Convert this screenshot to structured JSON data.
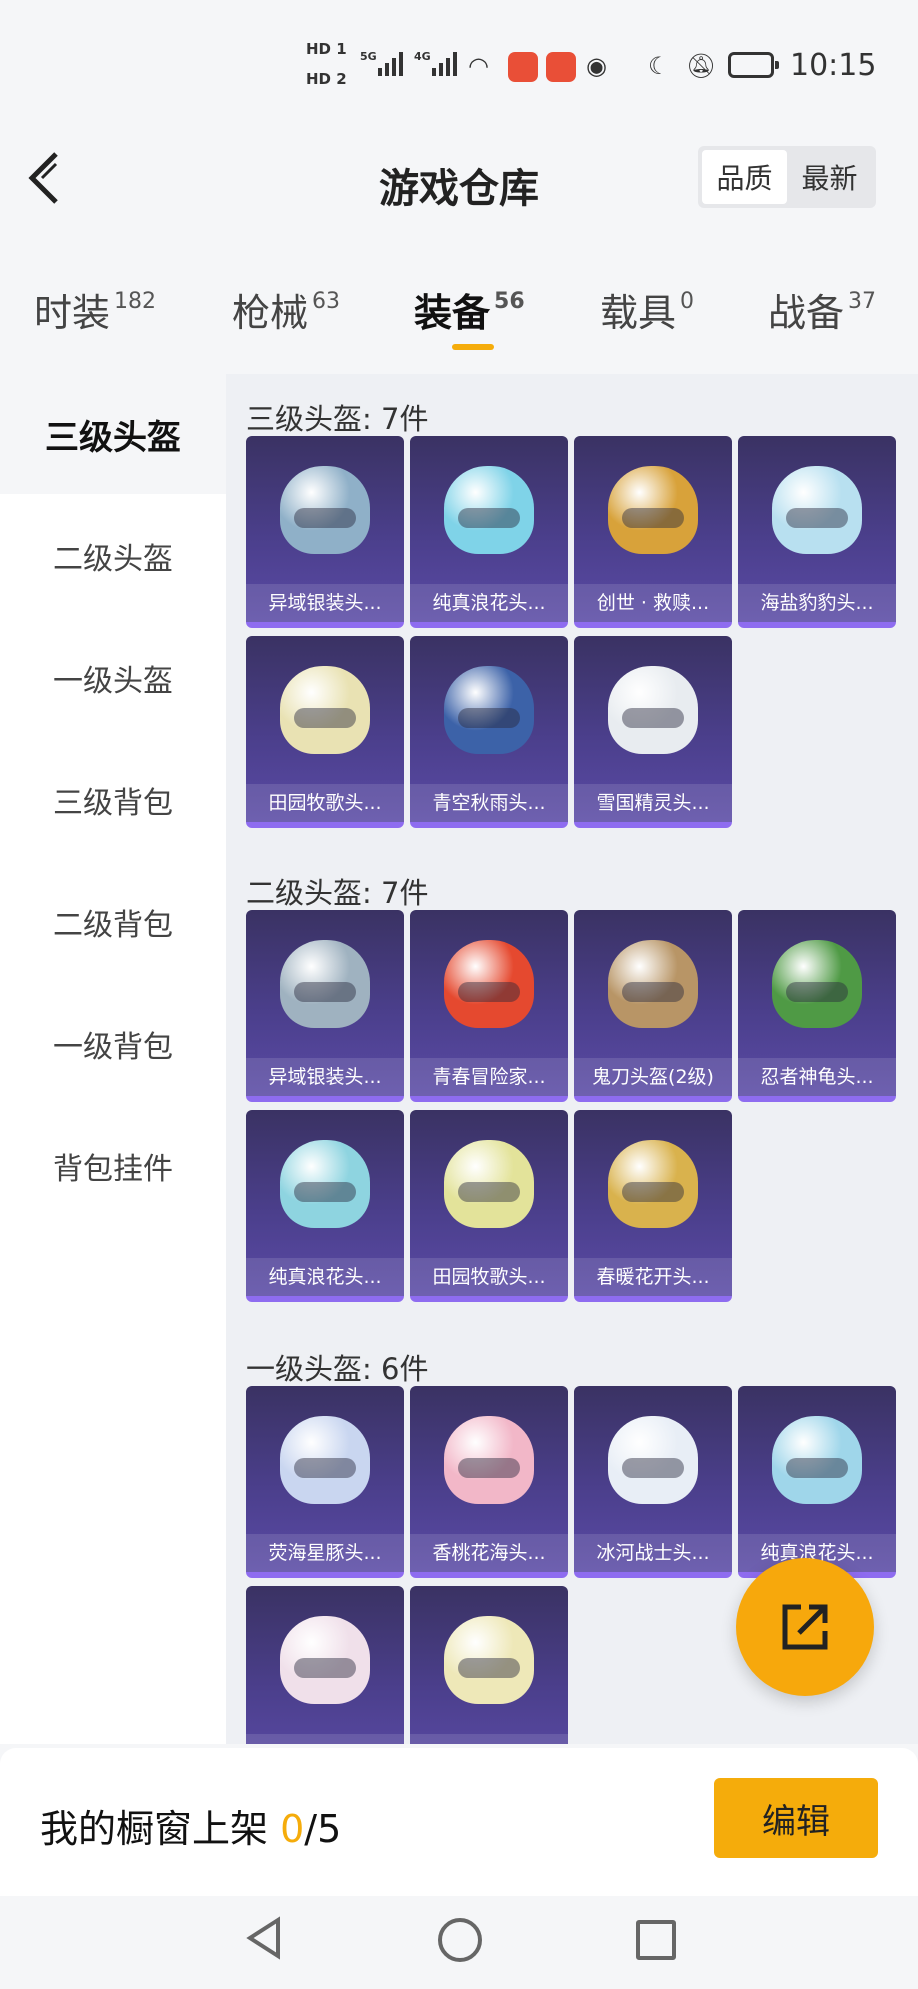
{
  "status_bar": {
    "sim1": "HD 1",
    "sim2": "HD 2",
    "net1": "5G",
    "net2": "4G",
    "time": "10:15"
  },
  "header": {
    "title": "游戏仓库",
    "sort_options": [
      "品质",
      "最新"
    ],
    "active_sort": "品质"
  },
  "tabs": [
    {
      "label": "时装",
      "count": "182"
    },
    {
      "label": "枪械",
      "count": "63"
    },
    {
      "label": "装备",
      "count": "56",
      "active": true
    },
    {
      "label": "载具",
      "count": "0"
    },
    {
      "label": "战备",
      "count": "37"
    }
  ],
  "sidebar": [
    {
      "label": "三级头盔",
      "active": true
    },
    {
      "label": "二级头盔"
    },
    {
      "label": "一级头盔"
    },
    {
      "label": "三级背包"
    },
    {
      "label": "二级背包"
    },
    {
      "label": "一级背包"
    },
    {
      "label": "背包挂件"
    }
  ],
  "sections": [
    {
      "title": "三级头盔: 7件",
      "items": [
        {
          "name": "异域银装头...",
          "color": "#8fb0c8"
        },
        {
          "name": "纯真浪花头...",
          "color": "#7fd3e8"
        },
        {
          "name": "创世 · 救赎...",
          "color": "#d8a23a"
        },
        {
          "name": "海盐豹豹头...",
          "color": "#b8e0f0"
        },
        {
          "name": "田园牧歌头...",
          "color": "#e9e2b3"
        },
        {
          "name": "青空秋雨头...",
          "color": "#3c62a8"
        },
        {
          "name": "雪国精灵头...",
          "color": "#e8ecf0"
        }
      ]
    },
    {
      "title": "二级头盔: 7件",
      "items": [
        {
          "name": "异域银装头...",
          "color": "#9fb2c0"
        },
        {
          "name": "青春冒险家...",
          "color": "#e5492f"
        },
        {
          "name": "鬼刀头盔(2级)",
          "color": "#b89566"
        },
        {
          "name": "忍者神龟头...",
          "color": "#4f9a45"
        },
        {
          "name": "纯真浪花头...",
          "color": "#8ed4e0"
        },
        {
          "name": "田园牧歌头...",
          "color": "#e3e39a"
        },
        {
          "name": "春暖花开头...",
          "color": "#d9b24d"
        }
      ]
    },
    {
      "title": "一级头盔: 6件",
      "items": [
        {
          "name": "荧海星豚头...",
          "color": "#c9d6f0"
        },
        {
          "name": "香桃花海头...",
          "color": "#f2b7c8"
        },
        {
          "name": "冰河战士头...",
          "color": "#e8eef6"
        },
        {
          "name": "纯真浪花头...",
          "color": "#9fd6ea"
        },
        {
          "name": "",
          "color": "#f0e0ea"
        },
        {
          "name": "",
          "color": "#eee8b8"
        }
      ]
    }
  ],
  "bottom": {
    "shelf_label": "我的橱窗上架",
    "shelf_used": "0",
    "shelf_total": "/5",
    "edit_label": "编辑"
  }
}
